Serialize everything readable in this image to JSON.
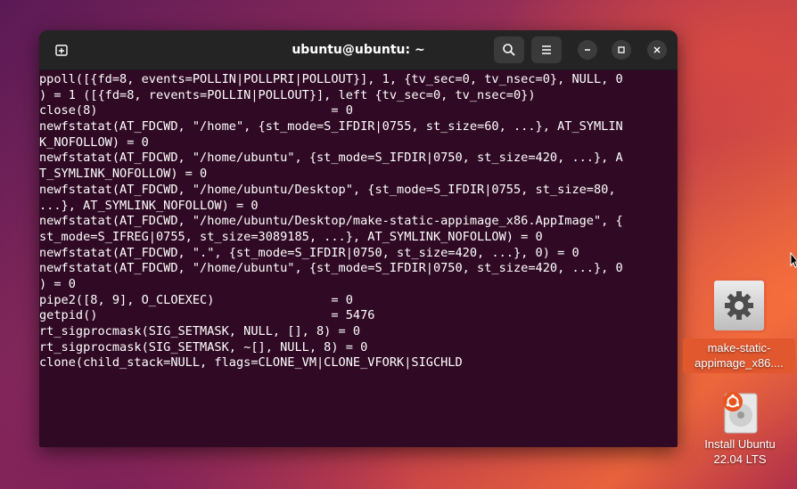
{
  "window": {
    "title": "ubuntu@ubuntu: ~",
    "icons": {
      "new_tab": "new-tab-icon",
      "search": "search-icon",
      "menu": "hamburger-menu-icon",
      "minimize": "minimize-icon",
      "maximize": "maximize-icon",
      "close": "close-icon"
    }
  },
  "terminal": {
    "lines": [
      "ppoll([{fd=8, events=POLLIN|POLLPRI|POLLOUT}], 1, {tv_sec=0, tv_nsec=0}, NULL, 0",
      ") = 1 ([{fd=8, revents=POLLIN|POLLOUT}], left {tv_sec=0, tv_nsec=0})",
      "close(8)                                = 0",
      "newfstatat(AT_FDCWD, \"/home\", {st_mode=S_IFDIR|0755, st_size=60, ...}, AT_SYMLIN",
      "K_NOFOLLOW) = 0",
      "newfstatat(AT_FDCWD, \"/home/ubuntu\", {st_mode=S_IFDIR|0750, st_size=420, ...}, A",
      "T_SYMLINK_NOFOLLOW) = 0",
      "newfstatat(AT_FDCWD, \"/home/ubuntu/Desktop\", {st_mode=S_IFDIR|0755, st_size=80,",
      "...}, AT_SYMLINK_NOFOLLOW) = 0",
      "newfstatat(AT_FDCWD, \"/home/ubuntu/Desktop/make-static-appimage_x86.AppImage\", {",
      "st_mode=S_IFREG|0755, st_size=3089185, ...}, AT_SYMLINK_NOFOLLOW) = 0",
      "newfstatat(AT_FDCWD, \".\", {st_mode=S_IFDIR|0750, st_size=420, ...}, 0) = 0",
      "newfstatat(AT_FDCWD, \"/home/ubuntu\", {st_mode=S_IFDIR|0750, st_size=420, ...}, 0",
      ") = 0",
      "pipe2([8, 9], O_CLOEXEC)                = 0",
      "getpid()                                = 5476",
      "rt_sigprocmask(SIG_SETMASK, NULL, [], 8) = 0",
      "rt_sigprocmask(SIG_SETMASK, ~[], NULL, 8) = 0",
      "clone(child_stack=NULL, flags=CLONE_VM|CLONE_VFORK|SIGCHLD"
    ],
    "colors": {
      "background": "#300a24",
      "text": "#ffffff"
    }
  },
  "desktop": {
    "icons": [
      {
        "label_line1": "make-static-",
        "label_line2": "appimage_x86....",
        "icon": "gear-icon"
      },
      {
        "label_line1": "Install Ubuntu",
        "label_line2": "22.04 LTS",
        "icon": "ubuntu-installer-icon"
      }
    ],
    "colors": {
      "selection": "#e1572e"
    }
  }
}
